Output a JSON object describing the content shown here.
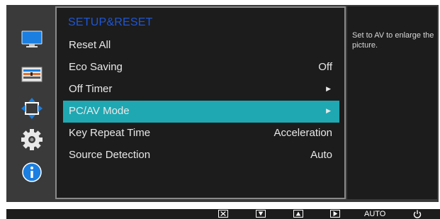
{
  "menu": {
    "title": "SETUP&RESET",
    "rows": [
      {
        "label": "Reset All",
        "value": "",
        "arrow": false
      },
      {
        "label": "Eco Saving",
        "value": "Off",
        "arrow": false
      },
      {
        "label": "Off Timer",
        "value": "",
        "arrow": true
      },
      {
        "label": "PC/AV Mode",
        "value": "",
        "arrow": true,
        "selected": true
      },
      {
        "label": "Key Repeat Time",
        "value": "Acceleration",
        "arrow": false
      },
      {
        "label": "Source Detection",
        "value": "Auto",
        "arrow": false
      }
    ]
  },
  "description": "Set to AV to enlarge the picture.",
  "sidebar": {
    "icons": [
      "monitor-icon",
      "color-bars-icon",
      "resize-arrows-icon",
      "settings-gear-icon",
      "info-icon"
    ]
  },
  "bottom_bar": {
    "buttons": [
      {
        "icon": "close-icon"
      },
      {
        "icon": "arrow-down-icon"
      },
      {
        "icon": "arrow-up-icon"
      },
      {
        "icon": "arrow-right-icon"
      },
      {
        "label": "AUTO"
      },
      {
        "icon": "power-icon"
      }
    ]
  },
  "colors": {
    "selected_row": "#1fa8b2",
    "title": "#1e56d6",
    "accent_blue": "#1a7fe0"
  }
}
